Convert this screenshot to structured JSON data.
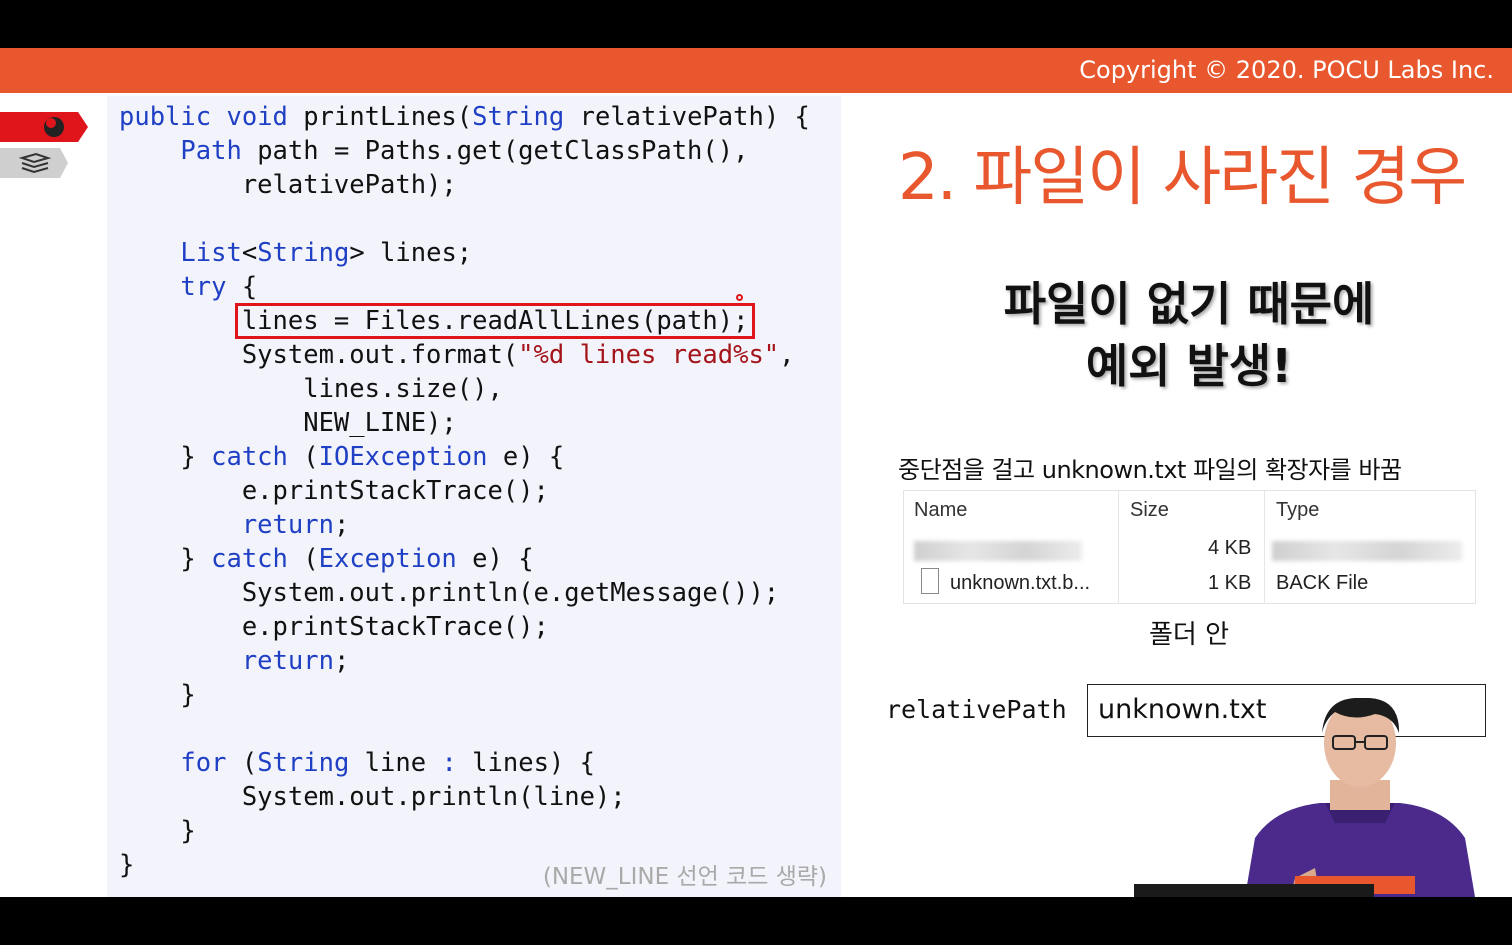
{
  "header": {
    "copyright": "Copyright © 2020. POCU Labs Inc."
  },
  "side_tags": {
    "top_icon": "brain-icon",
    "bottom_icon": "book-stack-icon"
  },
  "code": {
    "lines": [
      [
        [
          "k",
          "public"
        ],
        [
          "p",
          " "
        ],
        [
          "k",
          "void"
        ],
        [
          "p",
          " printLines("
        ],
        [
          "k",
          "String"
        ],
        [
          "p",
          " relativePath) {"
        ]
      ],
      [
        [
          "p",
          "    "
        ],
        [
          "k",
          "Path"
        ],
        [
          "p",
          " path = Paths.get(getClassPath(),"
        ]
      ],
      [
        [
          "p",
          "        relativePath);"
        ]
      ],
      [
        [
          "p",
          ""
        ]
      ],
      [
        [
          "p",
          "    "
        ],
        [
          "k",
          "List"
        ],
        [
          "p",
          "<"
        ],
        [
          "k",
          "String"
        ],
        [
          "p",
          "> lines;"
        ]
      ],
      [
        [
          "p",
          "    "
        ],
        [
          "k",
          "try"
        ],
        [
          "p",
          " {"
        ]
      ],
      [
        [
          "p",
          "        lines = Files.readAllLines(path);"
        ]
      ],
      [
        [
          "p",
          "        System.out.format("
        ],
        [
          "s",
          "\"%d lines read%s\""
        ],
        [
          "p",
          ","
        ]
      ],
      [
        [
          "p",
          "            lines.size(),"
        ]
      ],
      [
        [
          "p",
          "            NEW_LINE);"
        ]
      ],
      [
        [
          "p",
          "    } "
        ],
        [
          "k",
          "catch"
        ],
        [
          "p",
          " ("
        ],
        [
          "k",
          "IOException"
        ],
        [
          "p",
          " e) {"
        ]
      ],
      [
        [
          "p",
          "        e.printStackTrace();"
        ]
      ],
      [
        [
          "p",
          "        "
        ],
        [
          "k",
          "return"
        ],
        [
          "p",
          ";"
        ]
      ],
      [
        [
          "p",
          "    } "
        ],
        [
          "k",
          "catch"
        ],
        [
          "p",
          " ("
        ],
        [
          "k",
          "Exception"
        ],
        [
          "p",
          " e) {"
        ]
      ],
      [
        [
          "p",
          "        System.out.println(e.getMessage());"
        ]
      ],
      [
        [
          "p",
          "        e.printStackTrace();"
        ]
      ],
      [
        [
          "p",
          "        "
        ],
        [
          "k",
          "return"
        ],
        [
          "p",
          ";"
        ]
      ],
      [
        [
          "p",
          "    }"
        ]
      ],
      [
        [
          "p",
          ""
        ]
      ],
      [
        [
          "p",
          "    "
        ],
        [
          "k",
          "for"
        ],
        [
          "p",
          " ("
        ],
        [
          "k",
          "String"
        ],
        [
          "p",
          " line "
        ],
        [
          "k",
          ":"
        ],
        [
          "p",
          " lines) {"
        ]
      ],
      [
        [
          "p",
          "        System.out.println(line);"
        ]
      ],
      [
        [
          "p",
          "    }"
        ]
      ],
      [
        [
          "p",
          "}"
        ]
      ]
    ],
    "note": "(NEW_LINE 선언 코드 생략)"
  },
  "slide": {
    "title": "2. 파일이 사라진 경우",
    "subtitle_line1": "파일이 없기 때문에",
    "subtitle_line2": "예외 발생!",
    "caption": "중단점을 걸고 unknown.txt 파일의 확장자를 바꿈",
    "folder_label": "폴더 안"
  },
  "explorer": {
    "headers": {
      "name": "Name",
      "size": "Size",
      "type": "Type"
    },
    "rows": [
      {
        "name": "",
        "size": "4 KB",
        "type": ""
      },
      {
        "name": "unknown.txt.b...",
        "size": "1 KB",
        "type": "BACK File"
      }
    ]
  },
  "relative_path": {
    "label": "relativePath",
    "value": "unknown.txt"
  },
  "colors": {
    "accent": "#e8572d",
    "keyword": "#1f3fc4",
    "string": "#a3151a",
    "highlight": "#e0141b"
  }
}
